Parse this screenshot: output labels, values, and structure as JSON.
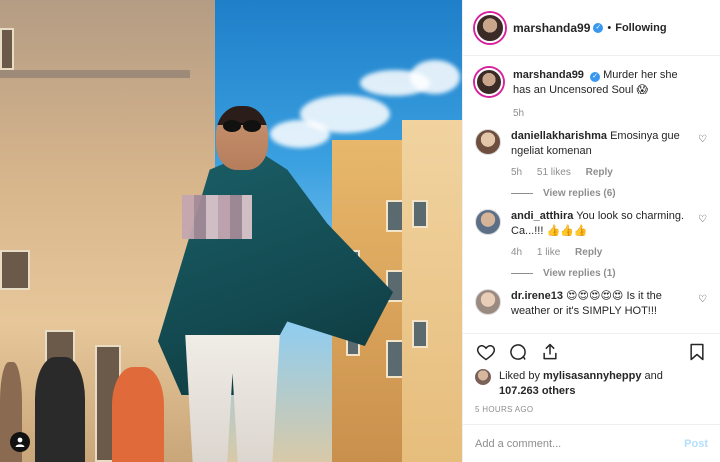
{
  "header": {
    "username": "marshanda99",
    "separator": "•",
    "follow_status": "Following"
  },
  "caption": {
    "username": "marshanda99",
    "text": "Murder her she has an Uncensored Soul 😱",
    "time": "5h"
  },
  "comments": [
    {
      "username": "daniellakharishma",
      "text": "Emosinya gue ngeliat komenan",
      "time": "5h",
      "likes": "51 likes",
      "reply_label": "Reply",
      "view_replies": "View replies (6)"
    },
    {
      "username": "andi_atthira",
      "text": "You look so charming. Ca...!!! 👍👍👍",
      "time": "4h",
      "likes": "1 like",
      "reply_label": "Reply",
      "view_replies": "View replies (1)"
    },
    {
      "username": "dr.irene13",
      "text": "😍😍😍😍😍 Is it the weather or it's SIMPLY HOT!!!"
    }
  ],
  "likes": {
    "prefix": "Liked by ",
    "user": "mylisasannyheppy",
    "conj": " and",
    "count": "107.263 others"
  },
  "post_time": "5 HOURS AGO",
  "add_comment": {
    "placeholder": "Add a comment...",
    "post_label": "Post"
  },
  "icons": {
    "like": "heart-icon",
    "comment": "comment-icon",
    "share": "share-icon",
    "save": "bookmark-icon",
    "verified": "verified-badge-icon",
    "tag": "user-tag-icon"
  },
  "colors": {
    "link_blue": "#3897f0",
    "post_disabled": "#b2dffc",
    "muted": "#8e8e8e",
    "text": "#262626"
  }
}
